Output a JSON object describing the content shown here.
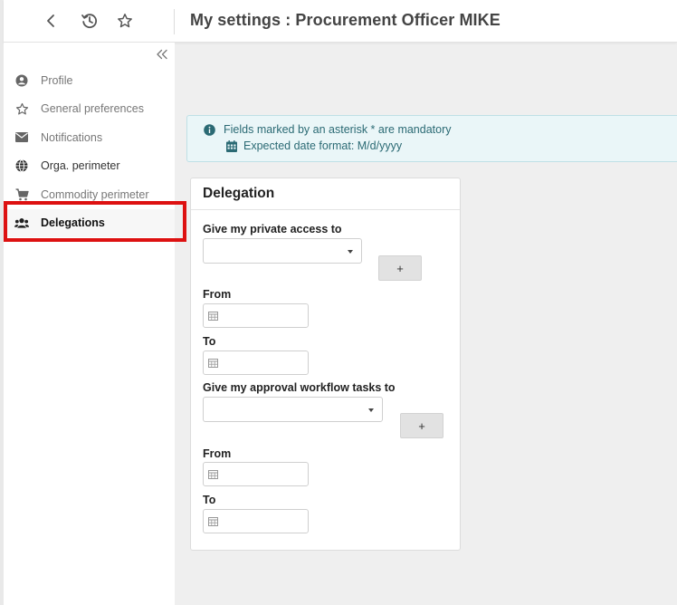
{
  "header": {
    "title": "My settings : Procurement Officer MIKE",
    "back_icon": "chevron-left-icon",
    "history_icon": "history-icon",
    "favorite_icon": "star-outline-icon"
  },
  "sidebar": {
    "collapse_icon": "double-chevron-left-icon",
    "items": [
      {
        "label": "Profile",
        "icon": "user-circle-icon"
      },
      {
        "label": "General preferences",
        "icon": "star-outline-icon"
      },
      {
        "label": "Notifications",
        "icon": "envelope-icon"
      },
      {
        "label": "Orga. perimeter",
        "icon": "globe-icon"
      },
      {
        "label": "Commodity perimeter",
        "icon": "cart-icon"
      },
      {
        "label": "Delegations",
        "icon": "users-icon",
        "active": true
      }
    ]
  },
  "info": {
    "mandatory_text": "Fields marked by an asterisk * are mandatory",
    "date_format_text": "Expected date format: M/d/yyyy",
    "accent_color": "#2b6a74"
  },
  "delegation": {
    "title": "Delegation",
    "private_access_label": "Give my private access to",
    "private_access_value": "",
    "add_label": "+",
    "from_label": "From",
    "to_label": "To",
    "approval_label": "Give my approval workflow tasks to",
    "approval_value": "",
    "from_value": "",
    "to_value": ""
  },
  "highlight_color": "#dd1111"
}
